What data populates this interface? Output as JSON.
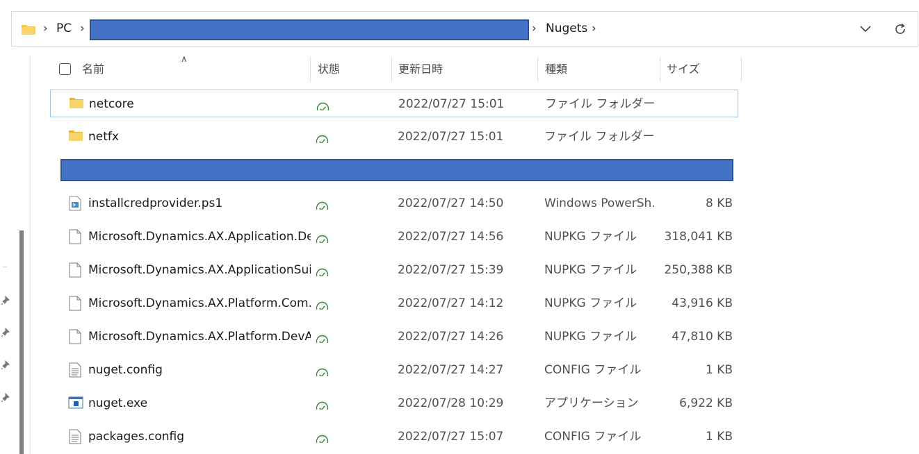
{
  "address": {
    "crumbs": [
      "PC",
      "Nugets"
    ],
    "separator": "›"
  },
  "columns": {
    "name": "名前",
    "status": "状態",
    "modified": "更新日時",
    "type": "種類",
    "size": "サイズ"
  },
  "rows": [
    {
      "name": "netcore",
      "icon": "folder-icon",
      "modified": "2022/07/27 15:01",
      "type": "ファイル フォルダー",
      "size": ""
    },
    {
      "name": "netfx",
      "icon": "folder-icon",
      "modified": "2022/07/27 15:01",
      "type": "ファイル フォルダー",
      "size": ""
    },
    {
      "name": "installcredprovider.ps1",
      "icon": "powershell-script-icon",
      "modified": "2022/07/27 14:50",
      "type": "Windows PowerSh...",
      "size": "8 KB"
    },
    {
      "name": "Microsoft.Dynamics.AX.Application.De...",
      "icon": "file-icon",
      "modified": "2022/07/27 14:56",
      "type": "NUPKG ファイル",
      "size": "318,041 KB"
    },
    {
      "name": "Microsoft.Dynamics.AX.ApplicationSui...",
      "icon": "file-icon",
      "modified": "2022/07/27 15:39",
      "type": "NUPKG ファイル",
      "size": "250,388 KB"
    },
    {
      "name": "Microsoft.Dynamics.AX.Platform.Com...",
      "icon": "file-icon",
      "modified": "2022/07/27 14:12",
      "type": "NUPKG ファイル",
      "size": "43,916 KB"
    },
    {
      "name": "Microsoft.Dynamics.AX.Platform.DevA...",
      "icon": "file-icon",
      "modified": "2022/07/27 14:26",
      "type": "NUPKG ファイル",
      "size": "47,810 KB"
    },
    {
      "name": "nuget.config",
      "icon": "config-file-icon",
      "modified": "2022/07/27 14:27",
      "type": "CONFIG ファイル",
      "size": "1 KB"
    },
    {
      "name": "nuget.exe",
      "icon": "application-icon",
      "modified": "2022/07/28 10:29",
      "type": "アプリケーション",
      "size": "6,922 KB"
    },
    {
      "name": "packages.config",
      "icon": "config-file-icon",
      "modified": "2022/07/27 15:07",
      "type": "CONFIG ファイル",
      "size": "1 KB"
    }
  ],
  "colors": {
    "redaction": "#4472c4",
    "sync_check": "#2e8b3a",
    "folder": "#f4c542",
    "selection_border": "#99c9ef"
  }
}
